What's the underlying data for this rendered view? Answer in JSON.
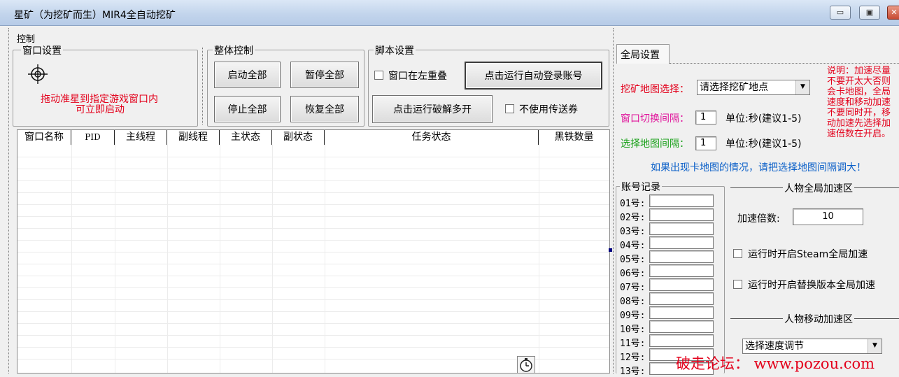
{
  "window": {
    "title": "星矿（为挖矿而生）MIR4全自动挖矿",
    "minimize": "▭",
    "maximize": "▣",
    "close": "✕"
  },
  "menu": {
    "control": "控制"
  },
  "window_settings": {
    "label": "窗口设置",
    "crosshair_icon": "crosshair-icon",
    "hint_line1": "拖动准星到指定游戏窗口内",
    "hint_line2": "可立即启动"
  },
  "overall_control": {
    "label": "整体控制",
    "start_all": "启动全部",
    "pause_all": "暂停全部",
    "stop_all": "停止全部",
    "resume_all": "恢复全部"
  },
  "script_settings": {
    "label": "脚本设置",
    "window_left_stack": "窗口在左重叠",
    "auto_login": "点击运行自动登录账号",
    "crack_multi": "点击运行破解多开",
    "no_teleport": "不使用传送券"
  },
  "table": {
    "columns": [
      "窗口名称",
      "PID",
      "主线程",
      "副线程",
      "主状态",
      "副状态",
      "任务状态",
      "黑铁数量"
    ]
  },
  "global_settings": {
    "tab": "全局设置",
    "map_select_label": "挖矿地图选择：",
    "map_select_value": "请选择挖矿地点",
    "window_interval_label": "窗口切换间隔：",
    "window_interval_value": "1",
    "window_interval_unit": "单位:秒(建议1-5)",
    "map_interval_label": "选择地图间隔：",
    "map_interval_value": "1",
    "map_interval_unit": "单位:秒(建议1-5)",
    "notice_line1": "说明：加速尽量",
    "notice_line2": "不要开太大否则",
    "notice_line3": "会卡地图，全局",
    "notice_line4": "速度和移动加速",
    "notice_line5": "不要同时开，移",
    "notice_line6": "动加速先选择加",
    "notice_line7": "速倍数在开启。",
    "stuck_hint": "如果出现卡地图的情况，请把选择地图间隔调大！"
  },
  "accounts": {
    "label": "账号记录",
    "rows": [
      "01号:",
      "02号:",
      "03号:",
      "04号:",
      "05号:",
      "06号:",
      "07号:",
      "08号:",
      "09号:",
      "10号:",
      "11号:",
      "12号:",
      "13号:"
    ]
  },
  "global_speed": {
    "label": "人物全局加速区",
    "multiplier_label": "加速倍数:",
    "multiplier_value": "10",
    "steam_speed": "运行时开启Steam全局加速",
    "alt_speed": "运行时开启替换版本全局加速"
  },
  "move_speed": {
    "label": "人物移动加速区",
    "select_value": "选择速度调节"
  },
  "watermark": "破走论坛：  www.pozou.com",
  "colors": {
    "accent_red": "#e3001b",
    "magenta": "#e0129a",
    "green": "#18a018",
    "blue": "#0a5fc8"
  }
}
